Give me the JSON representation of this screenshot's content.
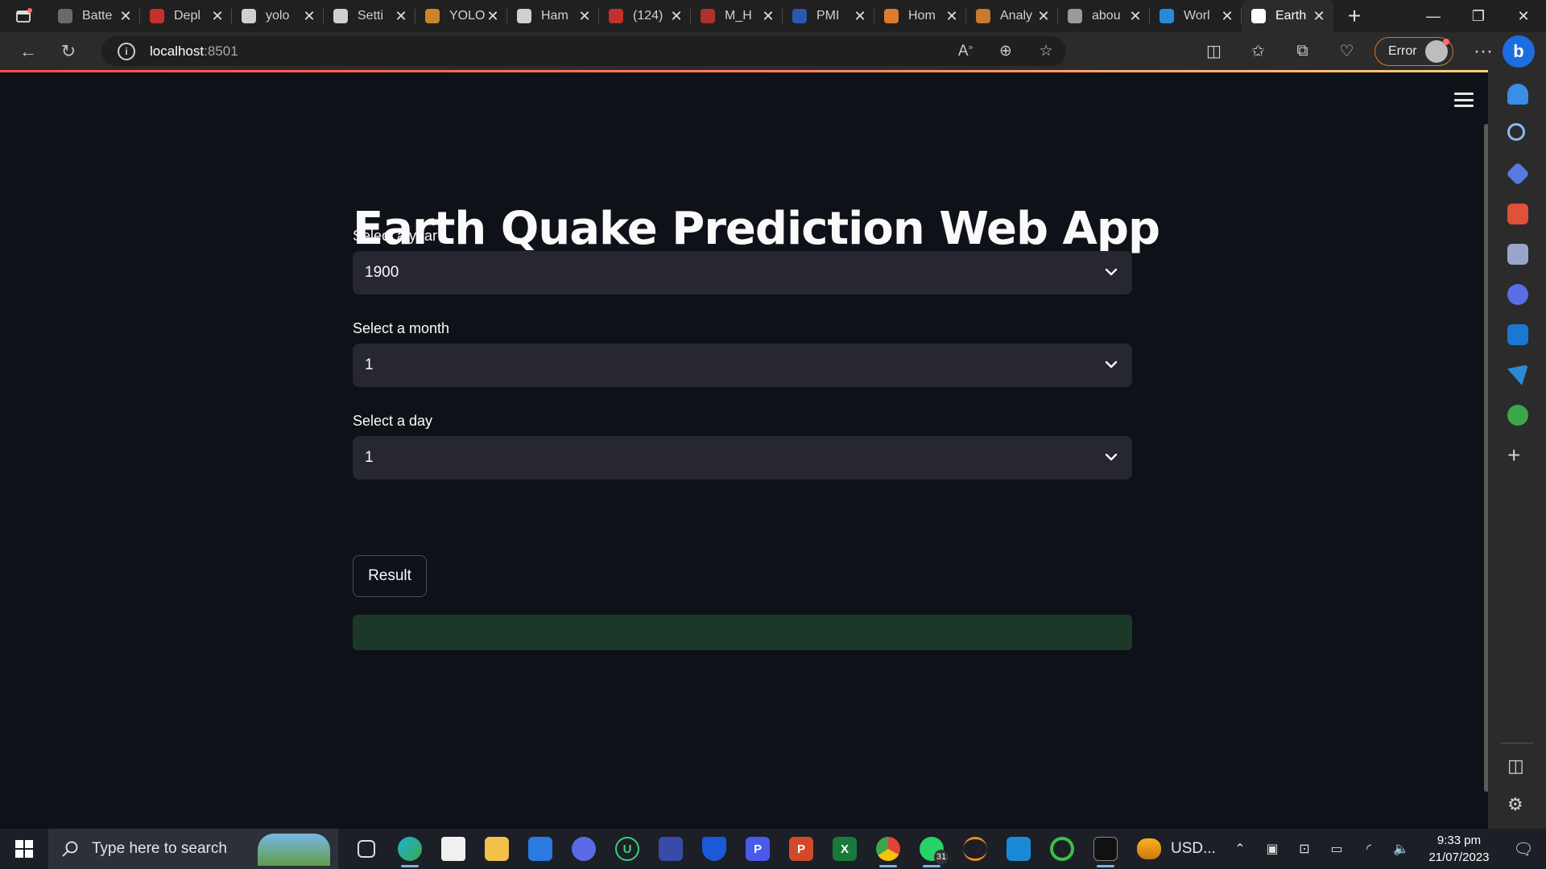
{
  "browser": {
    "tabs": [
      {
        "title": "Batte",
        "fav_color": "#6a6a6a"
      },
      {
        "title": "Depl",
        "fav_color": "#c4302b"
      },
      {
        "title": "yolo",
        "fav_color": "#d0d0d0"
      },
      {
        "title": "Setti",
        "fav_color": "#d0d0d0"
      },
      {
        "title": "YOLO",
        "fav_color": "#c8852a"
      },
      {
        "title": "Ham",
        "fav_color": "#d0d0d0"
      },
      {
        "title": "(124)",
        "fav_color": "#c4302b"
      },
      {
        "title": "M_H",
        "fav_color": "#b03030"
      },
      {
        "title": "PMI",
        "fav_color": "#2a5ab0"
      },
      {
        "title": "Hom",
        "fav_color": "#e07a30"
      },
      {
        "title": "Analy",
        "fav_color": "#c87a30"
      },
      {
        "title": "abou",
        "fav_color": "#9a9a9a"
      },
      {
        "title": "Worl",
        "fav_color": "#2a8ad8"
      },
      {
        "title": "Earth",
        "fav_color": "#ffffff"
      }
    ],
    "address": {
      "host": "localhost",
      "port": ":8501"
    },
    "profile_status": "Error",
    "bing_label": "b"
  },
  "app": {
    "title": "Earth Quake Prediction Web App",
    "fields": {
      "year": {
        "label": "Select a year",
        "value": "1900"
      },
      "month": {
        "label": "Select a month",
        "value": "1"
      },
      "day": {
        "label": "Select a day",
        "value": "1"
      }
    },
    "button_label": "Result",
    "result_text": "",
    "colors": {
      "background": "#0e1117",
      "select_bg": "#262730",
      "result_bg": "#1c3829",
      "accent": "#ff4b4b"
    }
  },
  "taskbar": {
    "search_placeholder": "Type here to search",
    "whatsapp_badge": "31",
    "weather_label": "USD...",
    "time": "9:33 pm",
    "date": "21/07/2023"
  },
  "icons": [
    "tab-actions-icon",
    "close-icon",
    "new-tab-icon",
    "minimize-icon",
    "restore-icon",
    "back-icon",
    "refresh-icon",
    "info-icon",
    "read-aloud-icon",
    "zoom-icon",
    "favorite-star-icon",
    "split-screen-icon",
    "favorites-icon",
    "collections-icon",
    "health-icon",
    "more-icon",
    "hamburger-menu-icon",
    "chevron-down-icon",
    "windows-start-icon",
    "search-icon"
  ]
}
